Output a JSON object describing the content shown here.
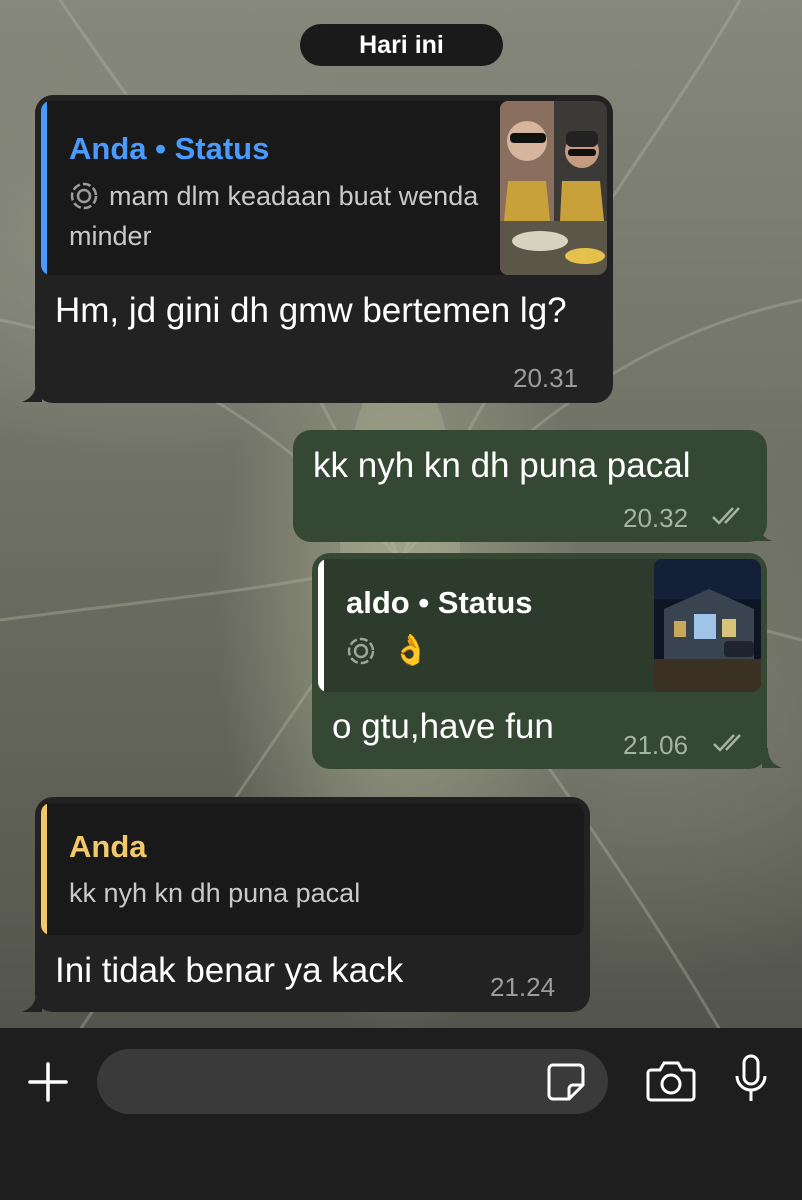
{
  "header": {
    "date_label": "Hari ini"
  },
  "messages": [
    {
      "direction": "incoming",
      "quote": {
        "title": "Anda • Status",
        "text": "mam dlm keadaan buat wenda minder",
        "accent": "#4a9bff",
        "thumbnail": "selfie-photo"
      },
      "text": "Hm, jd gini dh gmw bertemen lg?",
      "time": "20.31"
    },
    {
      "direction": "outgoing",
      "text": "kk nyh kn dh puna pacal",
      "time": "20.32",
      "status": "read"
    },
    {
      "direction": "outgoing",
      "quote": {
        "title": "aldo • Status",
        "text": "👌",
        "accent": "#ffffff",
        "thumbnail": "night-building-photo"
      },
      "text": "o gtu,have fun",
      "time": "21.06",
      "status": "read"
    },
    {
      "direction": "incoming",
      "quote": {
        "title": "Anda",
        "text": "kk nyh kn dh puna pacal",
        "accent": "#f2c86b"
      },
      "text": "Ini tidak benar ya kack",
      "time": "21.24"
    }
  ],
  "composer": {
    "placeholder": "",
    "icons": [
      "plus-icon",
      "sticker-icon",
      "camera-icon",
      "microphone-icon"
    ]
  },
  "colors": {
    "incoming_bubble": "#222222",
    "outgoing_bubble": "#354833"
  }
}
